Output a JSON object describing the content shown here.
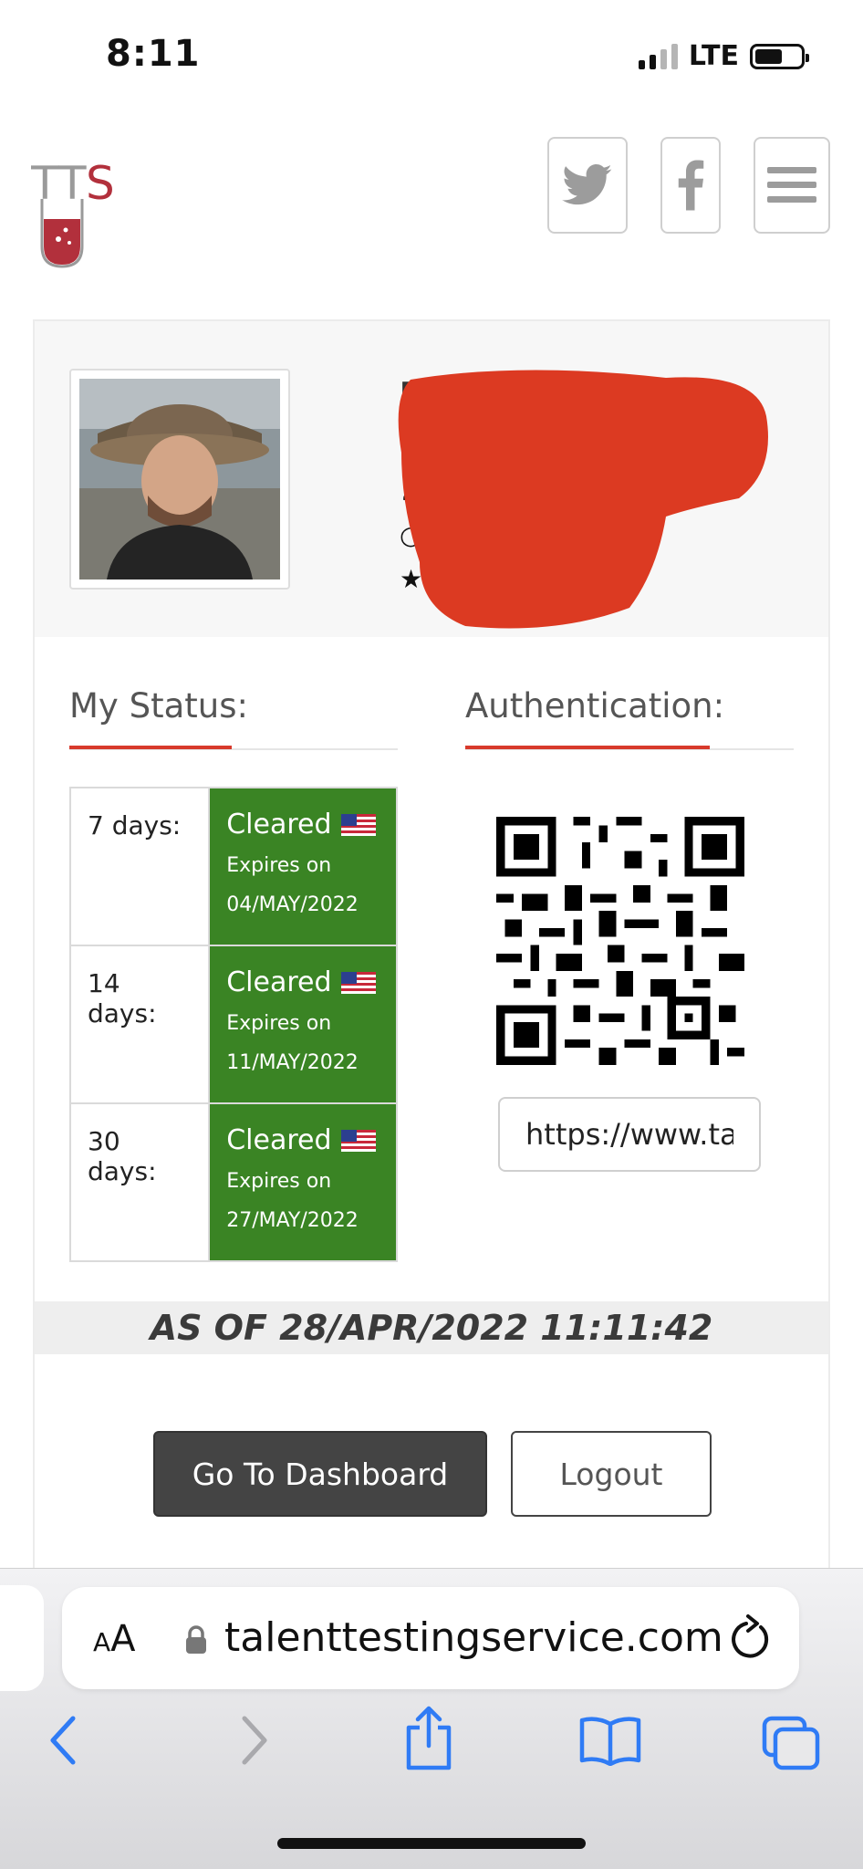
{
  "status_bar": {
    "time": "8:11",
    "network": "LTE"
  },
  "header": {
    "logo_text": "TTS",
    "twitter_icon": "twitter-icon",
    "facebook_icon": "facebook-icon",
    "menu_icon": "hamburger-menu-icon"
  },
  "profile": {
    "name_initial": "M",
    "icons": [
      "person-icon",
      "circle-icon",
      "star-icon"
    ]
  },
  "status_section": {
    "title": "My Status:",
    "rows": [
      {
        "period": "7 days:",
        "status": "Cleared",
        "expires_label": "Expires on",
        "expires_date": "04/MAY/2022"
      },
      {
        "period": "14 days:",
        "status": "Cleared",
        "expires_label": "Expires on",
        "expires_date": "11/MAY/2022"
      },
      {
        "period": "30 days:",
        "status": "Cleared",
        "expires_label": "Expires on",
        "expires_date": "27/MAY/2022"
      }
    ],
    "cleared_color": "#3a8424"
  },
  "auth_section": {
    "title": "Authentication:",
    "url_value": "https://www.ta"
  },
  "as_of": "AS OF 28/APR/2022 11:11:42",
  "buttons": {
    "dashboard": "Go To Dashboard",
    "logout": "Logout"
  },
  "browser": {
    "aa_label_small": "A",
    "aa_label_large": "A",
    "domain": "talenttestingservice.com",
    "accent": "#2f7bf5"
  },
  "colors": {
    "accent_red": "#d83a2c"
  }
}
